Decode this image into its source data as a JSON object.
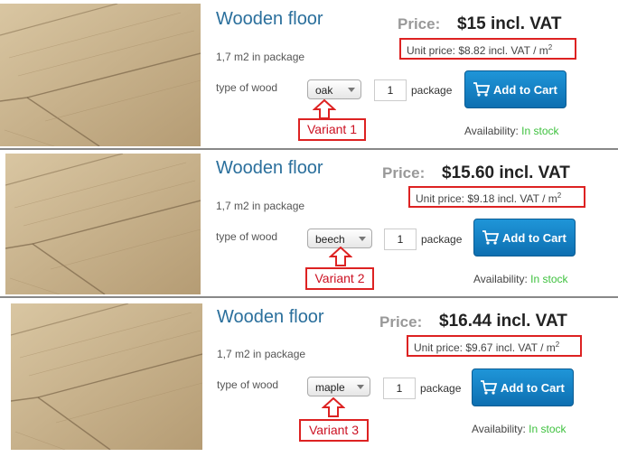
{
  "products": [
    {
      "title": "Wooden floor",
      "package_info": "1,7 m2 in package",
      "wood_label": "type of wood",
      "wood_selected": "oak",
      "quantity": "1",
      "quantity_unit": "package",
      "cart_label": "Add to Cart",
      "price_label": "Price:",
      "price_value": "$15 incl. VAT",
      "unit_price": "Unit price: $8.82 incl. VAT / m",
      "unit_sup": "2",
      "availability_label": "Availability:",
      "availability_value": "In stock",
      "variant_label": "Variant 1"
    },
    {
      "title": "Wooden floor",
      "package_info": "1,7 m2 in package",
      "wood_label": "type of wood",
      "wood_selected": "beech",
      "quantity": "1",
      "quantity_unit": "package",
      "cart_label": "Add to Cart",
      "price_label": "Price:",
      "price_value": "$15.60 incl. VAT",
      "unit_price": "Unit price: $9.18 incl. VAT / m",
      "unit_sup": "2",
      "availability_label": "Availability:",
      "availability_value": "In stock",
      "variant_label": "Variant 2"
    },
    {
      "title": "Wooden floor",
      "package_info": "1,7 m2 in package",
      "wood_label": "type of wood",
      "wood_selected": "maple",
      "quantity": "1",
      "quantity_unit": "package",
      "cart_label": "Add to Cart",
      "price_label": "Price:",
      "price_value": "$16.44 incl. VAT",
      "unit_price": "Unit price: $9.67 incl. VAT / m",
      "unit_sup": "2",
      "availability_label": "Availability:",
      "availability_value": "In stock",
      "variant_label": "Variant 3"
    }
  ],
  "colors": {
    "title": "#2a6f9c",
    "cart": "#1586cc",
    "in_stock": "#3ec13e",
    "highlight": "#dd2222"
  }
}
